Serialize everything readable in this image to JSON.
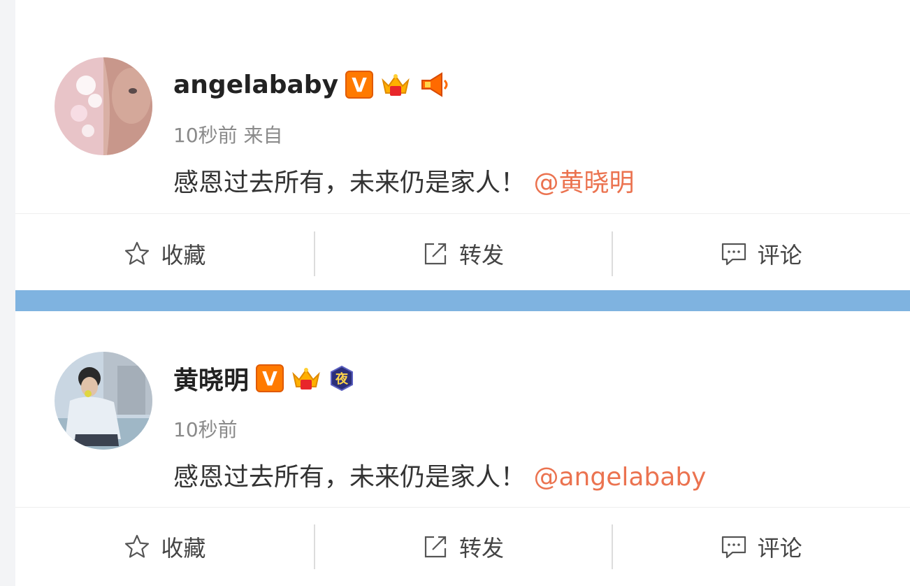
{
  "posts": [
    {
      "username": "angelababy",
      "badges": [
        "v-verified-badge",
        "crown-badge",
        "megaphone-badge"
      ],
      "time": "10秒前",
      "source": "来自",
      "text": "感恩过去所有，未来仍是家人！",
      "mention": "@黄晓明",
      "actions": {
        "favorite": "收藏",
        "repost": "转发",
        "comment": "评论"
      }
    },
    {
      "username": "黄晓明",
      "badges": [
        "v-verified-badge",
        "crown-badge",
        "night-badge"
      ],
      "time": "10秒前",
      "source": "",
      "text": "感恩过去所有，未来仍是家人！",
      "mention": "@angelababy",
      "night_badge_text": "夜",
      "actions": {
        "favorite": "收藏",
        "repost": "转发",
        "comment": "评论"
      }
    }
  ],
  "v_badge_text": "V",
  "colors": {
    "mention": "#eb7350",
    "divider_band": "#7fb3e0",
    "v_badge": "#ff7a00"
  }
}
